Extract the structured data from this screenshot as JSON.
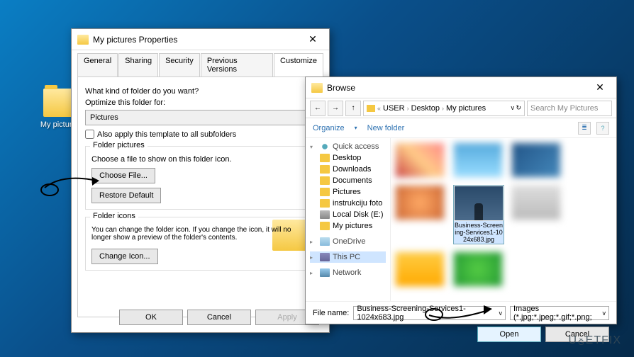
{
  "desktop": {
    "folder_label": "My pictures"
  },
  "properties": {
    "title": "My pictures Properties",
    "tabs": [
      "General",
      "Sharing",
      "Security",
      "Previous Versions",
      "Customize"
    ],
    "active_tab": 4,
    "optimize_label": "What kind of folder do you want?",
    "optimize_sub": "Optimize this folder for:",
    "optimize_value": "Pictures",
    "apply_subfolders": "Also apply this template to all subfolders",
    "folder_pictures_title": "Folder pictures",
    "folder_pictures_desc": "Choose a file to show on this folder icon.",
    "choose_file_btn": "Choose File...",
    "restore_default_btn": "Restore Default",
    "folder_icons_title": "Folder icons",
    "folder_icons_desc": "You can change the folder icon. If you change the icon, it will no longer show a preview of the folder's contents.",
    "change_icon_btn": "Change Icon...",
    "ok": "OK",
    "cancel": "Cancel",
    "apply": "Apply"
  },
  "browse": {
    "title": "Browse",
    "path": [
      "USER",
      "Desktop",
      "My pictures"
    ],
    "search_placeholder": "Search My Pictures",
    "organize": "Organize",
    "new_folder": "New folder",
    "sidebar": {
      "quick_access": "Quick access",
      "items": [
        "Desktop",
        "Downloads",
        "Documents",
        "Pictures",
        "instrukciju foto",
        "Local Disk (E:)",
        "My pictures"
      ],
      "onedrive": "OneDrive",
      "this_pc": "This PC",
      "network": "Network"
    },
    "selected_thumb": "Business-Screening-Services1-1024x683.jpg",
    "filename_label": "File name:",
    "filename_value": "Business-Screening-Services1-1024x683.jpg",
    "filter": "Images (*.jpg;*.jpeg;*.gif;*.png;",
    "open": "Open",
    "cancel": "Cancel"
  },
  "watermark": "UGETFIX"
}
